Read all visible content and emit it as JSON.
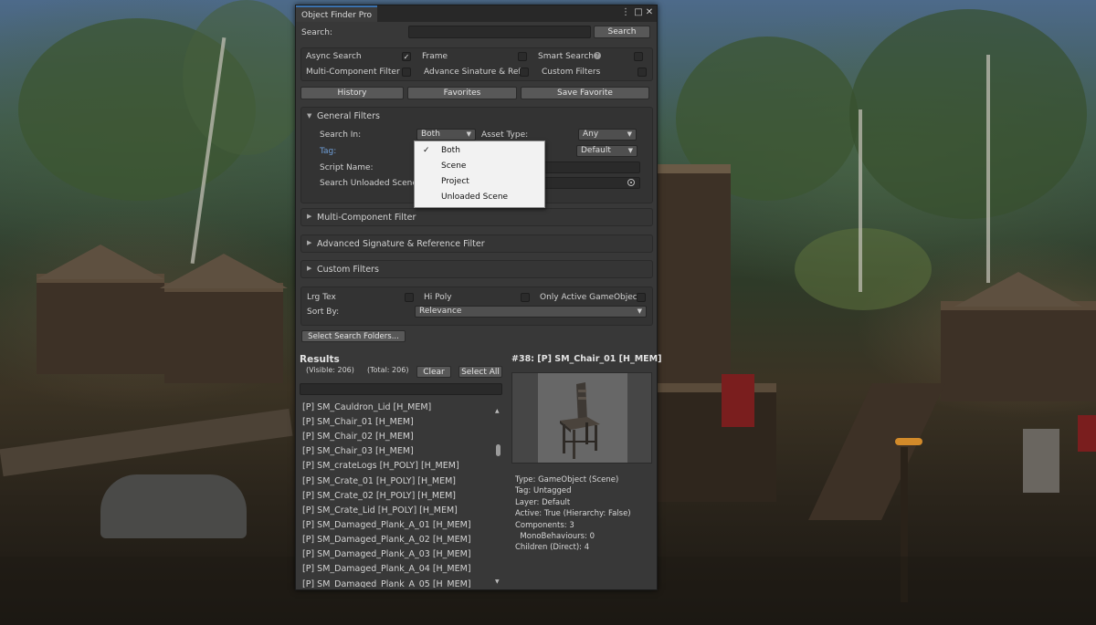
{
  "window": {
    "tab_title": "Object Finder Pro",
    "search_label": "Search:",
    "search_value": "",
    "search_button": "Search"
  },
  "options": {
    "row1": [
      {
        "label": "Async Search",
        "checked": true
      },
      {
        "label": "Frame",
        "checked": false
      },
      {
        "label": "Smart Search",
        "checked": false
      }
    ],
    "row2": [
      {
        "label": "Multi-Component Filter",
        "checked": false
      },
      {
        "label": "Advance Sinature & Ref",
        "checked": false
      },
      {
        "label": "Custom Filters",
        "checked": false
      }
    ]
  },
  "toolbar": {
    "history": "History",
    "favorites": "Favorites",
    "save_favorite": "Save Favorite"
  },
  "general_filters": {
    "title": "General Filters",
    "search_in_label": "Search In:",
    "search_in_value": "Both",
    "asset_type_label": "Asset Type:",
    "asset_type_value": "Any",
    "tag_label": "Tag:",
    "tag_value": "Default",
    "script_name_label": "Script Name:",
    "script_name_value": "",
    "search_unloaded_label": "Search Unloaded Scene"
  },
  "search_in_popup": {
    "options": [
      "Both",
      "Scene",
      "Project",
      "Unloaded Scene"
    ],
    "selected": "Both"
  },
  "foldouts": {
    "multi": "Multi-Component Filter",
    "advanced": "Advanced Signature & Reference Filter",
    "custom": "Custom Filters"
  },
  "extras": {
    "lrg_tex": "Lrg Tex",
    "hi_poly": "Hi Poly",
    "only_active": "Only Active GameObject",
    "sort_by_label": "Sort By:",
    "sort_by_value": "Relevance",
    "select_folders": "Select Search Folders..."
  },
  "results": {
    "title": "Results",
    "visible": "(Visible: 206)",
    "total": "(Total: 206)",
    "clear": "Clear",
    "select_all": "Select All",
    "filter_value": "",
    "items": [
      "[P] SM_Cauldron_Lid [H_MEM]",
      "[P] SM_Chair_01 [H_MEM]",
      "[P] SM_Chair_02 [H_MEM]",
      "[P] SM_Chair_03 [H_MEM]",
      "[P] SM_crateLogs [H_POLY] [H_MEM]",
      "[P] SM_Crate_01 [H_POLY] [H_MEM]",
      "[P] SM_Crate_02 [H_POLY] [H_MEM]",
      "[P] SM_Crate_Lid [H_POLY] [H_MEM]",
      "[P] SM_Damaged_Plank_A_01 [H_MEM]",
      "[P] SM_Damaged_Plank_A_02 [H_MEM]",
      "[P] SM_Damaged_Plank_A_03 [H_MEM]",
      "[P] SM_Damaged_Plank_A_04 [H_MEM]",
      "[P] SM_Damaged_Plank_A_05 [H_MEM]"
    ]
  },
  "detail": {
    "title": "#38: [P] SM_Chair_01 [H_MEM]",
    "lines": [
      "Type: GameObject (Scene)",
      "Tag: Untagged",
      "Layer: Default",
      "Active: True (Hierarchy: False)",
      "Components: 3",
      "  MonoBehaviours: 0",
      "Children (Direct): 4"
    ]
  },
  "colors": {
    "panel": "#383838",
    "accent": "#3a72b0",
    "tag_label": "#6f9fd8"
  }
}
